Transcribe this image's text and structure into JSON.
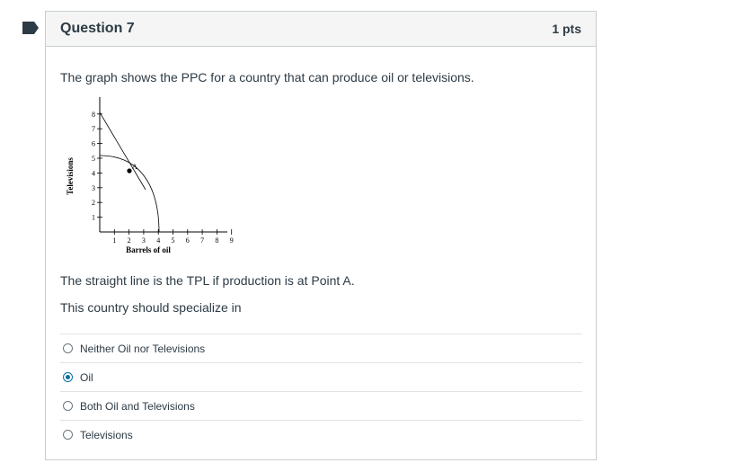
{
  "question": {
    "title": "Question 7",
    "points": "1 pts",
    "prompt": "The graph shows the PPC for a country that can produce oil or televisions.",
    "tpl_statement": "The straight line is the TPL if production is at Point A.",
    "specialize_statement": "This country should specialize in"
  },
  "graph": {
    "y_label": "Televisions",
    "x_label": "Barrels of oil",
    "y_ticks": [
      "1",
      "2",
      "3",
      "4",
      "5",
      "6",
      "7",
      "8"
    ],
    "x_ticks": [
      "1",
      "2",
      "3",
      "4",
      "5",
      "6",
      "7",
      "8",
      "9"
    ],
    "point_label": "A"
  },
  "answers": [
    {
      "label": "Neither Oil nor Televisions",
      "selected": false
    },
    {
      "label": "Oil",
      "selected": true
    },
    {
      "label": "Both Oil and Televisions",
      "selected": false
    },
    {
      "label": "Televisions",
      "selected": false
    }
  ],
  "colors": {
    "flag": "#2d3b45",
    "radio_selected": "#0770a3",
    "header_bg": "#f5f5f5"
  }
}
